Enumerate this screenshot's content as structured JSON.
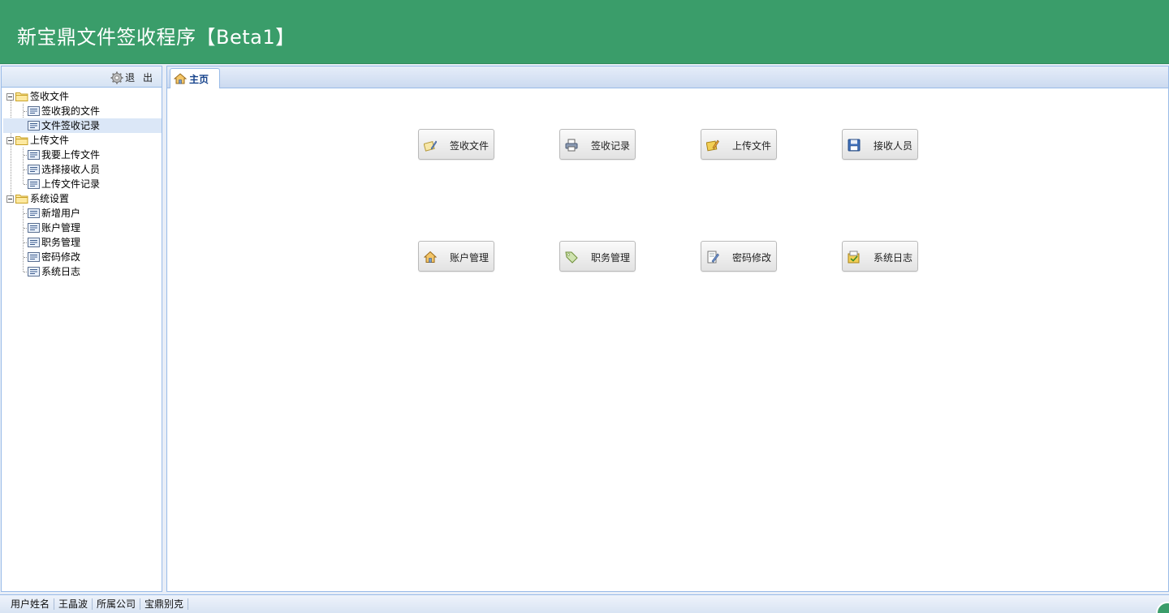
{
  "app": {
    "title": "新宝鼎文件签收程序【Beta1】"
  },
  "west": {
    "logout_label": "退 出",
    "tree": [
      {
        "label": "签收文件",
        "children": [
          "签收我的文件",
          "文件签收记录"
        ]
      },
      {
        "label": "上传文件",
        "children": [
          "我要上传文件",
          "选择接收人员",
          "上传文件记录"
        ]
      },
      {
        "label": "系统设置",
        "children": [
          "新增用户",
          "账户管理",
          "职务管理",
          "密码修改",
          "系统日志"
        ]
      }
    ],
    "selected": "文件签收记录"
  },
  "tabs": [
    {
      "label": "主页",
      "icon": "home-icon"
    }
  ],
  "buttons": [
    {
      "label": "签收文件",
      "icon": "sign-pen-icon"
    },
    {
      "label": "签收记录",
      "icon": "printer-icon"
    },
    {
      "label": "上传文件",
      "icon": "upload-pen-icon"
    },
    {
      "label": "接收人员",
      "icon": "save-disk-icon"
    },
    {
      "label": "账户管理",
      "icon": "home-icon"
    },
    {
      "label": "职务管理",
      "icon": "tag-icon"
    },
    {
      "label": "密码修改",
      "icon": "edit-doc-icon"
    },
    {
      "label": "系统日志",
      "icon": "log-icon"
    }
  ],
  "status": {
    "user_label": "用户姓名",
    "user_value": "王晶波",
    "company_label": "所属公司",
    "company_value": "宝鼎别克"
  },
  "colors": {
    "header": "#3a9d6a",
    "border": "#99bbe8",
    "tab_text": "#15428b"
  }
}
